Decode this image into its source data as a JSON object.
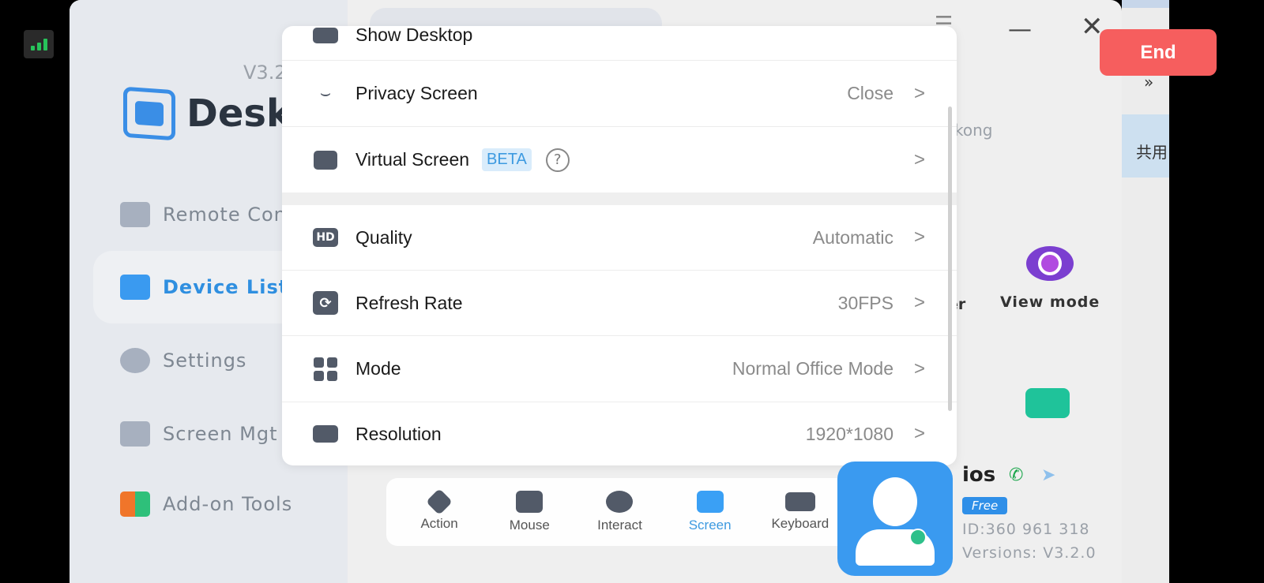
{
  "status": {
    "signal_icon": "signal-bars-icon"
  },
  "app": {
    "version": "V3.2",
    "brand": "DeskI"
  },
  "sidebar": {
    "items": [
      {
        "label": "Remote Cont",
        "icon": "remote-control-icon"
      },
      {
        "label": "Device List",
        "icon": "device-list-icon",
        "active": true
      },
      {
        "label": "Settings",
        "icon": "gear-icon"
      },
      {
        "label": "Screen Mgt",
        "icon": "screen-mgt-icon"
      },
      {
        "label": "Add-on Tools",
        "icon": "addon-tools-icon"
      }
    ]
  },
  "background": {
    "partial_user": "kong",
    "partial_label": "er",
    "view_mode": "View mode",
    "right_partial_text": "共用",
    "expand": "»"
  },
  "end_button": {
    "label": "End",
    "color": "#f65e5e"
  },
  "screen_menu": {
    "rows": [
      {
        "label": "Show Desktop",
        "value": "",
        "icon": "monitor-icon"
      },
      {
        "label": "Privacy Screen",
        "value": "Close",
        "icon": "eye-closed-icon"
      },
      {
        "label": "Virtual Screen",
        "badge": "BETA",
        "help": "?",
        "value": "",
        "icon": "virtual-screen-icon"
      },
      {
        "label": "Quality",
        "value": "Automatic",
        "icon": "hd-icon",
        "icon_text": "HD"
      },
      {
        "label": "Refresh Rate",
        "value": "30FPS",
        "icon": "refresh-icon",
        "icon_text": "⟳"
      },
      {
        "label": "Mode",
        "value": "Normal Office Mode",
        "icon": "grid-icon"
      },
      {
        "label": "Resolution",
        "value": "1920*1080",
        "icon": "resolution-icon"
      }
    ],
    "chevron": ">"
  },
  "toolbar": {
    "items": [
      {
        "label": "Action",
        "icon": "layers-icon"
      },
      {
        "label": "Mouse",
        "icon": "mouse-icon"
      },
      {
        "label": "Interact",
        "icon": "chat-icon"
      },
      {
        "label": "Screen",
        "icon": "screen-icon",
        "active": true
      },
      {
        "label": "Keyboard",
        "icon": "keyboard-icon"
      }
    ]
  },
  "device": {
    "name": "ios",
    "plan": "Free",
    "id": "ID:360 961 318",
    "version": "Versions: V3.2.0"
  }
}
